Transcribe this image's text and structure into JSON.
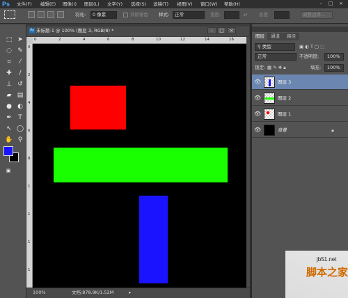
{
  "app": {
    "logo": "Ps"
  },
  "menubar": {
    "items": [
      "文件(F)",
      "编辑(E)",
      "图像(I)",
      "图层(L)",
      "文字(Y)",
      "选择(S)",
      "滤镜(T)",
      "视图(V)",
      "窗口(W)",
      "帮助(H)"
    ],
    "window_controls": [
      "–",
      "□",
      "×"
    ]
  },
  "options": {
    "feather_label": "羽化:",
    "feather_value": "0 像素",
    "antialias_label": "消除锯齿",
    "style_label": "样式:",
    "style_value": "正常",
    "width_label": "宽度:",
    "height_label": "高度:",
    "refine_edge": "调整边缘..."
  },
  "toolbox": {
    "tools": [
      "move-icon",
      "marquee-icon",
      "lasso-icon",
      "quick-select-icon",
      "crop-icon",
      "eyedropper-icon",
      "healing-icon",
      "brush-icon",
      "stamp-icon",
      "history-brush-icon",
      "eraser-icon",
      "gradient-icon",
      "blur-icon",
      "dodge-icon",
      "pen-icon",
      "type-icon",
      "path-select-icon",
      "shape-icon",
      "hand-icon",
      "zoom-icon"
    ],
    "foreground_color": "#1a13ff",
    "background_color": "#000000"
  },
  "document": {
    "tab_icon": "Ps",
    "tab_title": "未标题-1 @ 100% (图层 3, RGB/8) *",
    "ruler_top_labels": [
      "0",
      "2",
      "4",
      "6",
      "8",
      "10",
      "12",
      "14",
      "16"
    ],
    "ruler_left_labels": [
      "0",
      "2",
      "4",
      "6",
      "8",
      "1",
      "1",
      "1",
      "1"
    ],
    "canvas_background": "#000000",
    "shapes": [
      {
        "name": "red-rectangle",
        "color": "#ff0000"
      },
      {
        "name": "green-rectangle",
        "color": "#1aff00"
      },
      {
        "name": "blue-rectangle",
        "color": "#1a13ff"
      }
    ]
  },
  "statusbar": {
    "zoom": "100%",
    "doc_info": "文档:878.9K/1.52M"
  },
  "panel": {
    "tabs": [
      "图层",
      "通道",
      "路径"
    ],
    "filter_kind": "类型",
    "blend_mode": "正常",
    "opacity_label": "不透明度:",
    "opacity_value": "100%",
    "lock_label": "锁定:",
    "fill_label": "填充:",
    "fill_value": "100%",
    "layers": [
      {
        "name": "图层 3",
        "selected": true,
        "thumb_color": "#1a13ff"
      },
      {
        "name": "图层 2",
        "selected": false,
        "thumb_color": "#1aff00"
      },
      {
        "name": "图层 1",
        "selected": false,
        "thumb_color": "#ff0000"
      },
      {
        "name": "背景",
        "selected": false,
        "thumb_color": "#000000"
      }
    ]
  },
  "watermark": {
    "url": "jb51.net",
    "text": "脚本之家"
  }
}
